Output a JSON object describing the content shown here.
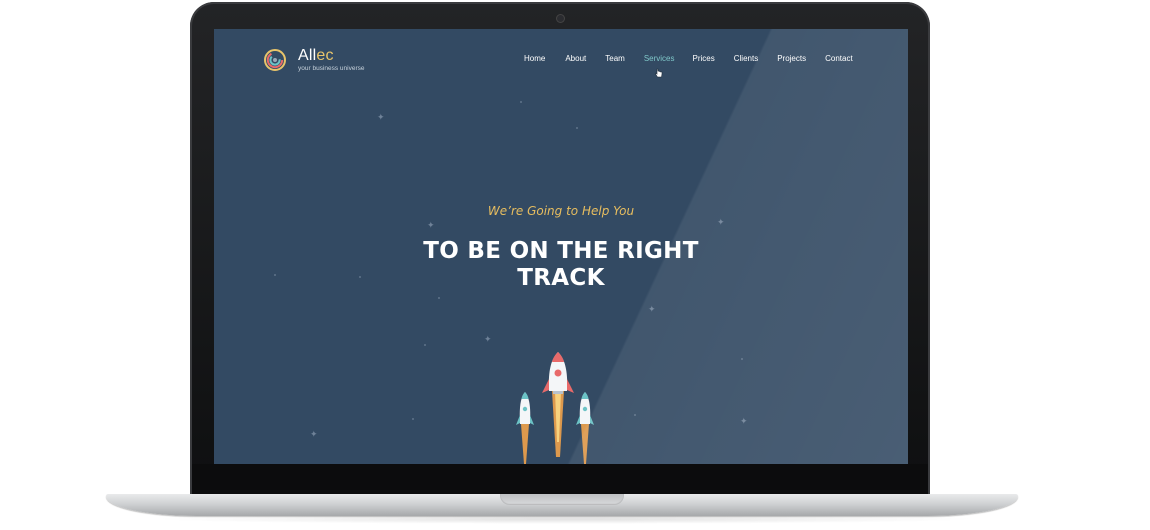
{
  "logo": {
    "name_main": "All",
    "name_accent": "ec",
    "tagline": "your business universe"
  },
  "nav": {
    "items": [
      {
        "label": "Home",
        "active": false
      },
      {
        "label": "About",
        "active": false
      },
      {
        "label": "Team",
        "active": false
      },
      {
        "label": "Services",
        "active": true
      },
      {
        "label": "Prices",
        "active": false
      },
      {
        "label": "Clients",
        "active": false
      },
      {
        "label": "Projects",
        "active": false
      },
      {
        "label": "Contact",
        "active": false
      }
    ]
  },
  "hero": {
    "subtitle": "We’re Going to Help You",
    "title_line1": "TO BE ON THE RIGHT",
    "title_line2": "TRACK"
  },
  "colors": {
    "screen_bg": "#334a63",
    "accent_gold": "#e7bd5f",
    "nav_active": "#7fc7c9",
    "rocket_body": "#f4f6f8",
    "rocket_main_accent": "#e86a6a",
    "rocket_side_accent": "#6cc3c6",
    "flame": "#f0a24a"
  },
  "icons": {
    "logo": "swirl-logo-icon",
    "cursor": "hand-pointer-icon",
    "rockets": "rocket-icon"
  }
}
